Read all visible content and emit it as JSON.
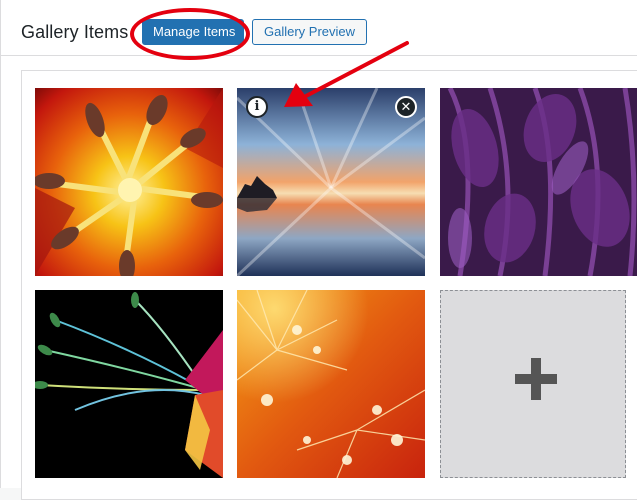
{
  "header": {
    "title": "Gallery Items",
    "manage_label": "Manage Items",
    "preview_label": "Gallery Preview"
  },
  "tiles": {
    "info_symbol": "i",
    "close_symbol": "✕",
    "add_symbol": "+",
    "images": [
      {
        "description": "lily-stamens",
        "has_overlay": false
      },
      {
        "description": "sunset-lake-reflection",
        "has_overlay": true
      },
      {
        "description": "purple-feathers",
        "has_overlay": false
      },
      {
        "description": "flower-on-black",
        "has_overlay": false
      },
      {
        "description": "dandelion-seed-drops",
        "has_overlay": false
      }
    ]
  },
  "annotation": {
    "color": "#e4000f",
    "highlight_target": "manage-items-button",
    "arrow_target": "info-icon"
  },
  "colors": {
    "primary": "#2271b1",
    "text": "#1d2327",
    "border": "#dcdcde",
    "add_bg": "#dcdcde",
    "plus": "#555555"
  }
}
